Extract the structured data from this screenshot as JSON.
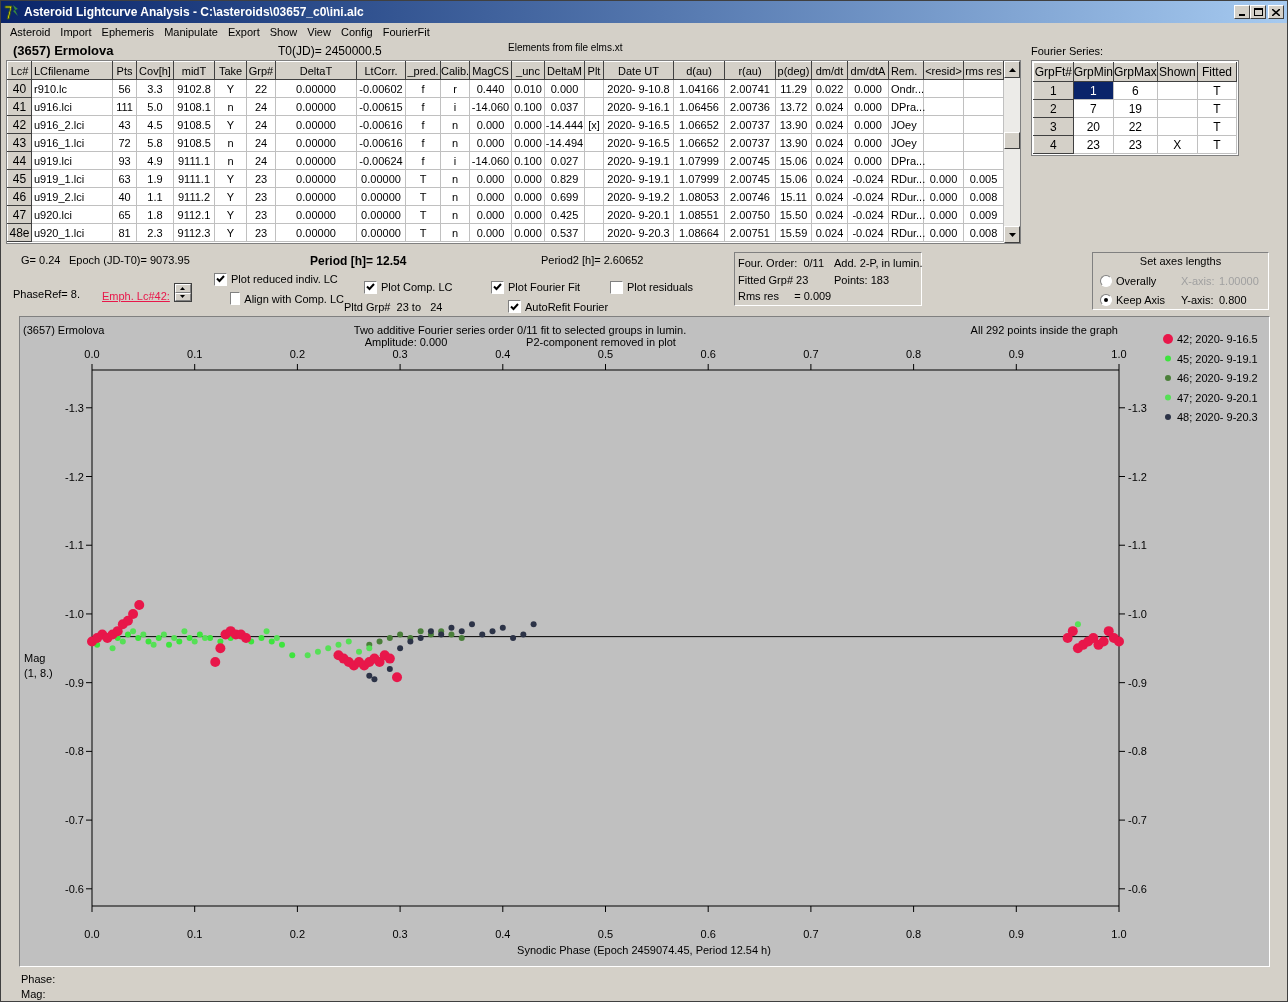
{
  "window": {
    "title": "Asteroid Lightcurve Analysis - C:\\asteroids\\03657_c0\\ini.alc"
  },
  "menu": [
    "Asteroid",
    "Import",
    "Ephemeris",
    "Manipulate",
    "Export",
    "Show",
    "View",
    "Config",
    "FourierFit"
  ],
  "header": {
    "object": "(3657) Ermolova",
    "t0": "T0(JD)= 2450000.5",
    "elements": "Elements from file elms.xt"
  },
  "lc_table": {
    "columns": [
      "Lc#",
      "LCfilename",
      "Pts",
      "Cov[h]",
      "midT",
      "Take",
      "Grp#",
      "DeltaT",
      "LtCorr.",
      "_pred.",
      "Calib.",
      "MagCS",
      "_unc",
      "DeltaM",
      "Plt",
      "Date UT",
      "d(au)",
      "r(au)",
      "p(deg)",
      "dm/dt",
      "dm/dtA",
      "Rem.",
      "<resid>",
      "rms res"
    ],
    "rows": [
      {
        "cells": [
          "40",
          "r910.lc",
          "56",
          "3.3",
          "9102.8",
          "Y",
          "22",
          "0.00000",
          "-0.00602",
          "f",
          "r",
          "0.440",
          "0.010",
          "0.000",
          null,
          "2020- 9-10.8",
          "1.04166",
          "2.00741",
          "11.29",
          "0.022",
          "0.000",
          "Ondr...",
          null,
          null
        ]
      },
      {
        "cells": [
          "41",
          "u916.lci",
          "111",
          "5.0",
          "9108.1",
          "n",
          "24",
          "0.00000",
          "-0.00615",
          "f",
          "i",
          "-14.060",
          "0.100",
          "0.037",
          null,
          "2020- 9-16.1",
          "1.06456",
          "2.00736",
          "13.72",
          "0.024",
          "0.000",
          "DPra...",
          null,
          null
        ]
      },
      {
        "cells": [
          "42",
          "u916_2.lci",
          "43",
          "4.5",
          "9108.5",
          "Y",
          "24",
          "0.00000",
          "-0.00616",
          "f",
          "n",
          "0.000",
          "0.000",
          "-14.444",
          "[x]",
          "2020- 9-16.5",
          "1.06652",
          "2.00737",
          "13.90",
          "0.024",
          "0.000",
          "JOey",
          null,
          null
        ]
      },
      {
        "cells": [
          "43",
          "u916_1.lci",
          "72",
          "5.8",
          "9108.5",
          "n",
          "24",
          "0.00000",
          "-0.00616",
          "f",
          "n",
          "0.000",
          "0.000",
          "-14.494",
          null,
          "2020- 9-16.5",
          "1.06652",
          "2.00737",
          "13.90",
          "0.024",
          "0.000",
          "JOey",
          null,
          null
        ]
      },
      {
        "cells": [
          "44",
          "u919.lci",
          "93",
          "4.9",
          "9111.1",
          "n",
          "24",
          "0.00000",
          "-0.00624",
          "f",
          "i",
          "-14.060",
          "0.100",
          "0.027",
          null,
          "2020- 9-19.1",
          "1.07999",
          "2.00745",
          "15.06",
          "0.024",
          "0.000",
          "DPra...",
          null,
          null
        ]
      },
      {
        "cells": [
          "45",
          "u919_1.lci",
          "63",
          "1.9",
          "9111.1",
          "Y",
          "23",
          "0.00000",
          "0.00000",
          "T",
          "n",
          "0.000",
          "0.000",
          "0.829",
          null,
          "2020- 9-19.1",
          "1.07999",
          "2.00745",
          "15.06",
          "0.024",
          "-0.024",
          "RDur...",
          "0.000",
          "0.005"
        ]
      },
      {
        "cells": [
          "46",
          "u919_2.lci",
          "40",
          "1.1",
          "9111.2",
          "Y",
          "23",
          "0.00000",
          "0.00000",
          "T",
          "n",
          "0.000",
          "0.000",
          "0.699",
          null,
          "2020- 9-19.2",
          "1.08053",
          "2.00746",
          "15.11",
          "0.024",
          "-0.024",
          "RDur...",
          "0.000",
          "0.008"
        ]
      },
      {
        "cells": [
          "47",
          "u920.lci",
          "65",
          "1.8",
          "9112.1",
          "Y",
          "23",
          "0.00000",
          "0.00000",
          "T",
          "n",
          "0.000",
          "0.000",
          "0.425",
          null,
          "2020- 9-20.1",
          "1.08551",
          "2.00750",
          "15.50",
          "0.024",
          "-0.024",
          "RDur...",
          "0.000",
          "0.009"
        ]
      },
      {
        "cells": [
          "48e",
          "u920_1.lci",
          "81",
          "2.3",
          "9112.3",
          "Y",
          "23",
          "0.00000",
          "0.00000",
          "T",
          "n",
          "0.000",
          "0.000",
          "0.537",
          null,
          "2020- 9-20.3",
          "1.08664",
          "2.00751",
          "15.59",
          "0.024",
          "-0.024",
          "RDur...",
          "0.000",
          "0.008"
        ]
      }
    ]
  },
  "fourier": {
    "title": "Fourier Series:",
    "columns": [
      "GrpFt#",
      "GrpMin",
      "GrpMax",
      "Shown",
      "Fitted"
    ],
    "rows": [
      {
        "cells": [
          {
            "text": "1",
            "selected": false
          },
          {
            "text": "1",
            "selected": true
          },
          {
            "text": "6",
            "selected": false
          },
          {
            "text": null,
            "selected": false
          },
          {
            "text": "T",
            "selected": false
          }
        ]
      },
      {
        "cells": [
          {
            "text": "2",
            "selected": false
          },
          {
            "text": "7",
            "selected": false
          },
          {
            "text": "19",
            "selected": false
          },
          {
            "text": null,
            "selected": false
          },
          {
            "text": "T",
            "selected": false
          }
        ]
      },
      {
        "cells": [
          {
            "text": "3",
            "selected": false
          },
          {
            "text": "20",
            "selected": false
          },
          {
            "text": "22",
            "selected": false
          },
          {
            "text": null,
            "selected": false
          },
          {
            "text": "T",
            "selected": false
          }
        ]
      },
      {
        "cells": [
          {
            "text": "4",
            "selected": false
          },
          {
            "text": "23",
            "selected": false
          },
          {
            "text": "23",
            "selected": false
          },
          {
            "text": "X",
            "selected": false
          },
          {
            "text": "T",
            "selected": false
          }
        ]
      }
    ]
  },
  "info": {
    "g": "G= 0.24",
    "epoch": "Epoch (JD-T0)= 9073.95",
    "period": "Period [h]= 12.54",
    "period2": "Period2 [h]= 2.60652",
    "phase_ref": "PhaseRef= 8.",
    "emph_link": "Emph. Lc#42:",
    "pltd_grp": "Pltd Grp#  23 to   24"
  },
  "checkboxes": [
    {
      "label": "Plot reduced indiv. LC",
      "checked": true
    },
    {
      "label": "Align with Comp. LC",
      "checked": false
    },
    {
      "label": "Plot Comp. LC",
      "checked": true
    },
    {
      "label": "Plot Fourier Fit",
      "checked": true
    },
    {
      "label": "AutoRefit Fourier",
      "checked": true
    },
    {
      "label": "Plot residuals",
      "checked": false
    }
  ],
  "fit_box": [
    "Four. Order:  0/11",
    "Add. 2-P, in lumin.",
    "Fitted Grp# 23",
    "Points: 183",
    "Rms res     = 0.009"
  ],
  "axes_group": {
    "title": "Set axes lengths",
    "radios": [
      {
        "label": "Overally",
        "selected": false
      },
      {
        "label": "Keep Axis",
        "selected": true
      }
    ],
    "fields": [
      {
        "label": "X-axis:",
        "value": "1.00000",
        "disabled": true
      },
      {
        "label": "Y-axis:",
        "value": "0.800",
        "disabled": false
      }
    ]
  },
  "plot": {
    "object": "(3657) Ermolova",
    "amplitude": "Amplitude: 0.000",
    "note": "P2-component removed in plot",
    "points_note": "All 292 points inside the graph",
    "ylabel_sub": "(1, 8.)",
    "large_markers": [
      true,
      false,
      false,
      false,
      false
    ],
    "chart_data": {
      "type": "scatter",
      "title": "Two additive Fourier series order 0/11 fit to selected groups in lumin.",
      "xlabel": "Synodic Phase (Epoch 2459074.45, Period 12.54 h)",
      "ylabel": "Mag",
      "xlim": [
        0,
        1
      ],
      "ylim": [
        -0.575,
        -1.355
      ],
      "xticks": [
        {
          "value": 0,
          "label": "0.0"
        },
        {
          "value": 0.1,
          "label": "0.1"
        },
        {
          "value": 0.2,
          "label": "0.2"
        },
        {
          "value": 0.3,
          "label": "0.3"
        },
        {
          "value": 0.4,
          "label": "0.4"
        },
        {
          "value": 0.5,
          "label": "0.5"
        },
        {
          "value": 0.6,
          "label": "0.6"
        },
        {
          "value": 0.7,
          "label": "0.7"
        },
        {
          "value": 0.8,
          "label": "0.8"
        },
        {
          "value": 0.9,
          "label": "0.9"
        },
        {
          "value": 1,
          "label": "1.0"
        }
      ],
      "yticks": [
        {
          "value": -1.3,
          "label": "-1.3"
        },
        {
          "value": -1.2,
          "label": "-1.2"
        },
        {
          "value": -1.1,
          "label": "-1.1"
        },
        {
          "value": -1.0,
          "label": "-1.0"
        },
        {
          "value": -0.9,
          "label": "-0.9"
        },
        {
          "value": -0.8,
          "label": "-0.8"
        },
        {
          "value": -0.7,
          "label": "-0.7"
        },
        {
          "value": -0.6,
          "label": "-0.6"
        }
      ],
      "ref_lines": [
        {
          "axis": "y",
          "value": -0.967
        }
      ],
      "legend": "right",
      "series": [
        {
          "name": "42; 2020- 9-16.5",
          "color": "#e8174a",
          "x": [
            0.0,
            0.005,
            0.01,
            0.015,
            0.02,
            0.025,
            0.03,
            0.035,
            0.04,
            0.046,
            0.12,
            0.125,
            0.13,
            0.135,
            0.14,
            0.145,
            0.15,
            0.24,
            0.245,
            0.25,
            0.255,
            0.26,
            0.265,
            0.27,
            0.275,
            0.28,
            0.285,
            0.29,
            0.297,
            0.95,
            0.955,
            0.96,
            0.965,
            0.97,
            0.975,
            0.98,
            0.985,
            0.99,
            0.995,
            1.0
          ],
          "values": [
            -0.96,
            -0.965,
            -0.97,
            -0.965,
            -0.97,
            -0.975,
            -0.985,
            -0.99,
            -1.0,
            -1.013,
            -0.93,
            -0.95,
            -0.97,
            -0.975,
            -0.97,
            -0.97,
            -0.965,
            -0.94,
            -0.935,
            -0.93,
            -0.925,
            -0.93,
            -0.925,
            -0.93,
            -0.935,
            -0.93,
            -0.94,
            -0.935,
            -0.908,
            -0.965,
            -0.975,
            -0.95,
            -0.955,
            -0.96,
            -0.965,
            -0.955,
            -0.96,
            -0.975,
            -0.965,
            -0.96
          ]
        },
        {
          "name": "45; 2020- 9-19.1",
          "color": "#3ee43e",
          "x": [
            0.005,
            0.025,
            0.035,
            0.045,
            0.055,
            0.065,
            0.075,
            0.085,
            0.095,
            0.105,
            0.115,
            0.125,
            0.135,
            0.155,
            0.165,
            0.175,
            0.185,
            0.195
          ],
          "values": [
            -0.955,
            -0.965,
            -0.97,
            -0.965,
            -0.96,
            -0.965,
            -0.955,
            -0.96,
            -0.965,
            -0.97,
            -0.965,
            -0.96,
            -0.965,
            -0.96,
            -0.965,
            -0.96,
            -0.955,
            -0.94
          ]
        },
        {
          "name": "46; 2020- 9-19.2",
          "color": "#4a7f3a",
          "x": [
            0.27,
            0.28,
            0.29,
            0.3,
            0.31,
            0.32,
            0.33,
            0.34,
            0.35,
            0.36
          ],
          "values": [
            -0.955,
            -0.96,
            -0.965,
            -0.97,
            -0.965,
            -0.975,
            -0.97,
            -0.975,
            -0.97,
            -0.965
          ]
        },
        {
          "name": "47; 2020- 9-20.1",
          "color": "#56e056",
          "x": [
            0.02,
            0.03,
            0.04,
            0.05,
            0.06,
            0.07,
            0.08,
            0.09,
            0.1,
            0.11,
            0.17,
            0.18,
            0.21,
            0.22,
            0.23,
            0.24,
            0.25,
            0.26,
            0.27,
            0.96
          ],
          "values": [
            -0.95,
            -0.96,
            -0.975,
            -0.97,
            -0.955,
            -0.97,
            -0.965,
            -0.975,
            -0.96,
            -0.965,
            -0.975,
            -0.965,
            -0.94,
            -0.945,
            -0.95,
            -0.955,
            -0.96,
            -0.945,
            -0.95,
            -0.985
          ]
        },
        {
          "name": "48; 2020- 9-20.3",
          "color": "#2c3347",
          "x": [
            0.27,
            0.275,
            0.29,
            0.3,
            0.31,
            0.32,
            0.33,
            0.34,
            0.35,
            0.36,
            0.37,
            0.38,
            0.39,
            0.4,
            0.41,
            0.42,
            0.43
          ],
          "values": [
            -0.91,
            -0.905,
            -0.92,
            -0.95,
            -0.96,
            -0.965,
            -0.975,
            -0.97,
            -0.98,
            -0.975,
            -0.985,
            -0.97,
            -0.975,
            -0.98,
            -0.965,
            -0.97,
            -0.985
          ]
        }
      ]
    }
  },
  "status": [
    "Phase:",
    "Mag:"
  ]
}
